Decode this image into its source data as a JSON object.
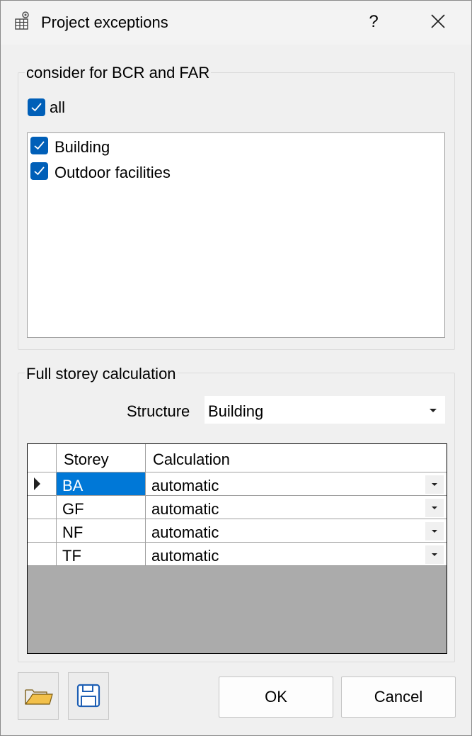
{
  "window": {
    "title": "Project exceptions",
    "help_label": "?"
  },
  "bcr_group": {
    "legend": "consider for BCR and FAR",
    "all_label": "all",
    "items": [
      {
        "label": "Building",
        "checked": true
      },
      {
        "label": "Outdoor facilities",
        "checked": true
      }
    ]
  },
  "storey_group": {
    "legend": "Full storey calculation",
    "structure_label": "Structure",
    "structure_value": "Building",
    "columns": {
      "storey": "Storey",
      "calculation": "Calculation"
    },
    "rows": [
      {
        "storey": "BA",
        "calculation": "automatic"
      },
      {
        "storey": "GF",
        "calculation": "automatic"
      },
      {
        "storey": "NF",
        "calculation": "automatic"
      },
      {
        "storey": "TF",
        "calculation": "automatic"
      }
    ]
  },
  "buttons": {
    "ok": "OK",
    "cancel": "Cancel"
  },
  "colors": {
    "accent": "#005fb8",
    "selection": "#0078d7",
    "grid_empty": "#ababab"
  },
  "icons": [
    "settings-table-icon",
    "close-icon",
    "open-folder-icon",
    "save-icon",
    "row-pointer-icon",
    "dropdown-arrow-icon"
  ]
}
